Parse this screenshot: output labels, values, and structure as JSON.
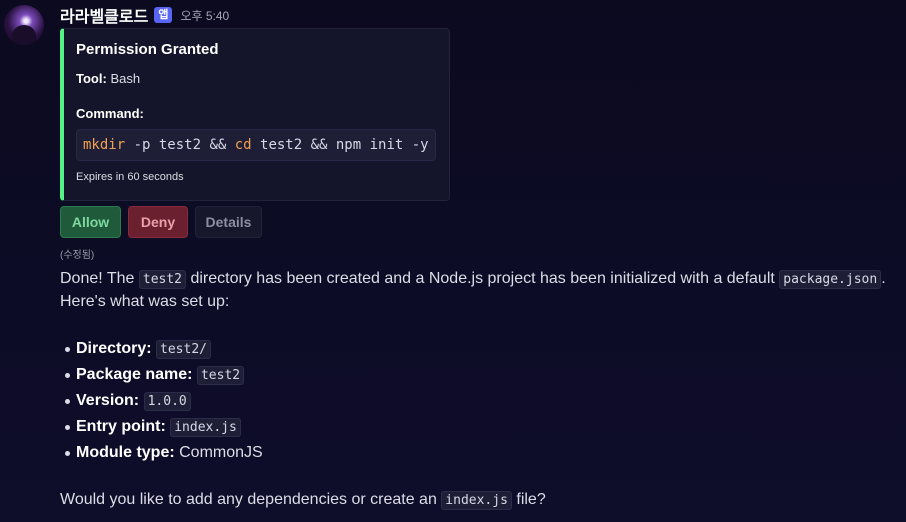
{
  "message": {
    "username": "라라벨클로드",
    "app_badge": "앱",
    "timestamp": "오후 5:40",
    "edited": "(수정됨)"
  },
  "embed": {
    "accent_color": "#57f287",
    "title": "Permission Granted",
    "tool_label": "Tool:",
    "tool_value": "Bash",
    "command_label": "Command:",
    "command_tokens": [
      "mkdir",
      " -p test2 && ",
      "cd",
      " test2 && npm init -y"
    ],
    "expires": "Expires in 60 seconds"
  },
  "buttons": {
    "allow": "Allow",
    "deny": "Deny",
    "details": "Details"
  },
  "content": {
    "intro_1": "Done! The ",
    "intro_code_1": "test2",
    "intro_2": " directory has been created and a Node.js project has been initialized with a default ",
    "intro_code_2": "package.json",
    "intro_3": ". Here's what was set up:",
    "list": [
      {
        "label": "Directory:",
        "value": "test2/",
        "code": true
      },
      {
        "label": "Package name:",
        "value": "test2",
        "code": true
      },
      {
        "label": "Version:",
        "value": "1.0.0",
        "code": true
      },
      {
        "label": "Entry point:",
        "value": "index.js",
        "code": true
      },
      {
        "label": "Module type:",
        "value": "CommonJS",
        "code": false
      }
    ],
    "outro_1": "Would you like to add any dependencies or create an ",
    "outro_code": "index.js",
    "outro_2": " file?"
  }
}
